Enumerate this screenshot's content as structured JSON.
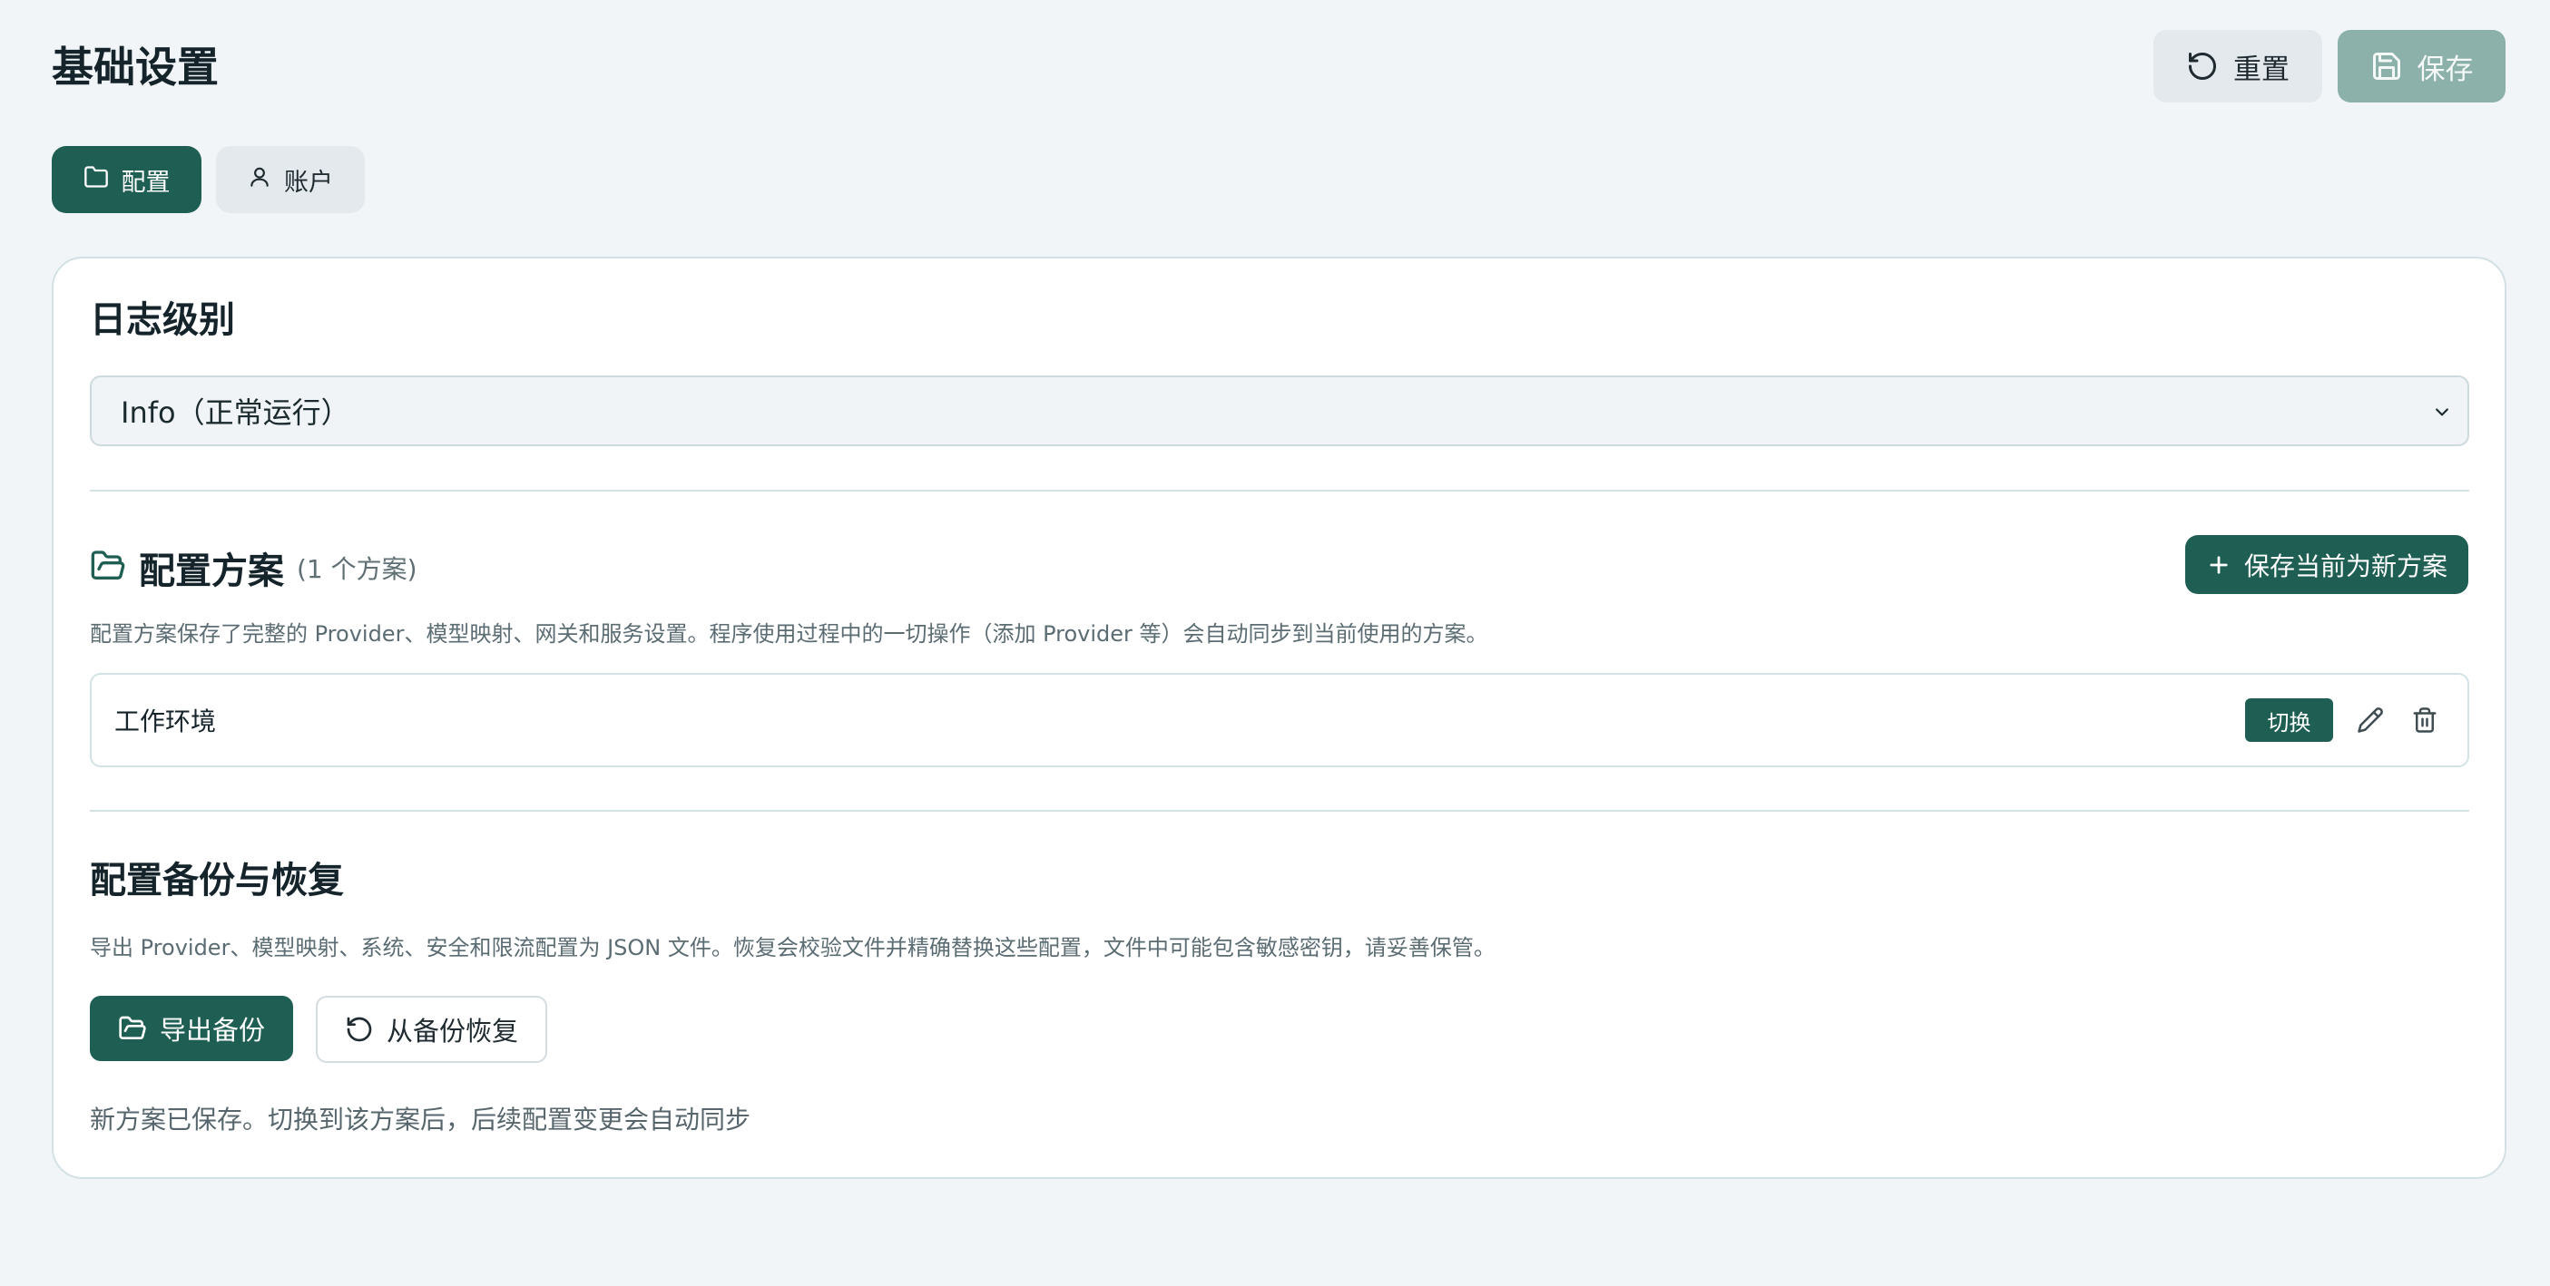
{
  "header": {
    "title": "基础设置",
    "reset_label": "重置",
    "save_label": "保存"
  },
  "tabs": [
    {
      "label": "配置",
      "icon": "folder-icon",
      "active": true
    },
    {
      "label": "账户",
      "icon": "user-icon",
      "active": false
    }
  ],
  "log_level": {
    "title": "日志级别",
    "selected": "Info（正常运行）"
  },
  "schemes": {
    "title": "配置方案",
    "count": "(1 个方案)",
    "new_button_label": "保存当前为新方案",
    "description": "配置方案保存了完整的 Provider、模型映射、网关和服务设置。程序使用过程中的一切操作（添加 Provider 等）会自动同步到当前使用的方案。",
    "items": [
      {
        "name": "工作环境",
        "switch_label": "切换"
      }
    ]
  },
  "backup": {
    "title": "配置备份与恢复",
    "description": "导出 Provider、模型映射、系统、安全和限流配置为 JSON 文件。恢复会校验文件并精确替换这些配置，文件中可能包含敏感密钥，请妥善保管。",
    "export_label": "导出备份",
    "restore_label": "从备份恢复"
  },
  "status_message": "新方案已保存。切换到该方案后，后续配置变更会自动同步",
  "colors": {
    "primary": "#1f5e53",
    "primary_disabled": "#8cb1aa",
    "background": "#f1f5f8"
  }
}
